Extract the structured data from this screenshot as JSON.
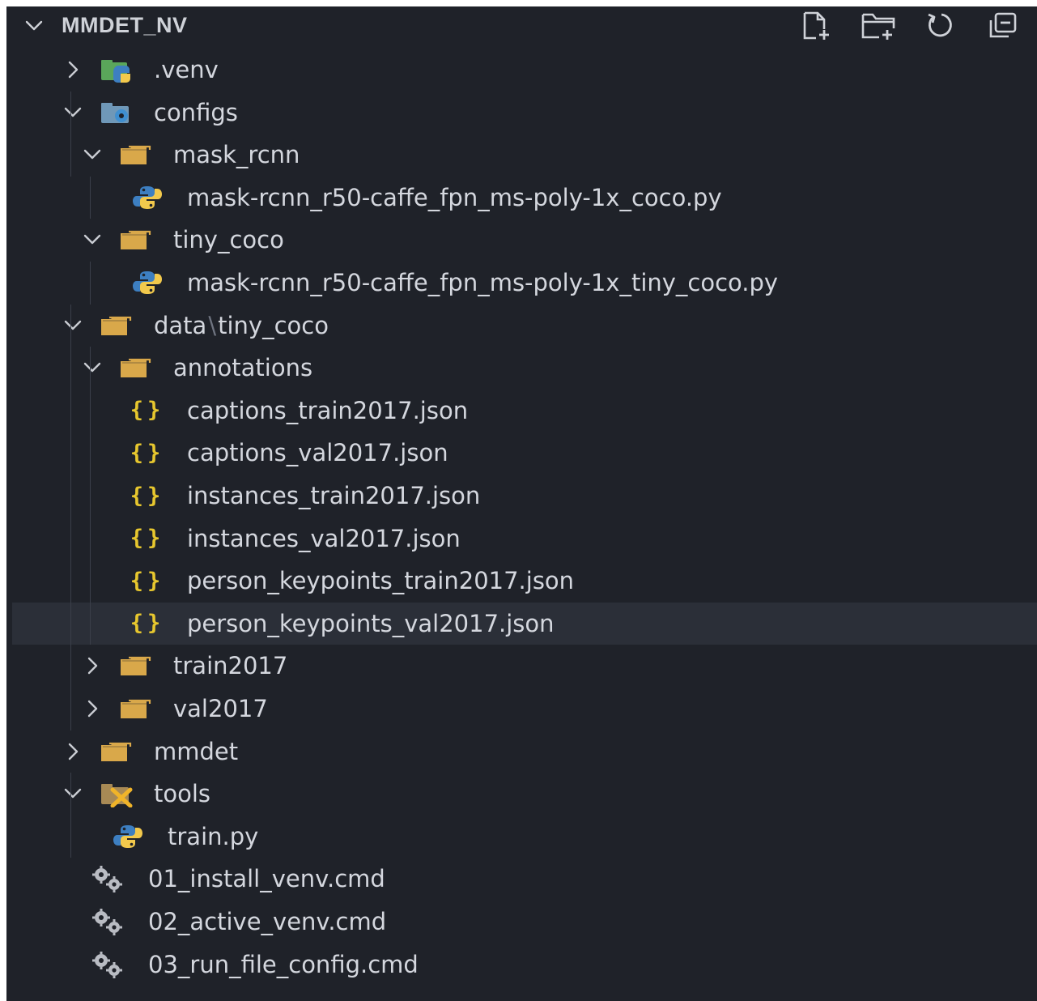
{
  "explorer": {
    "title": "MMDET_NV",
    "actions": {
      "new_file": "new-file-icon",
      "new_folder": "new-folder-icon",
      "refresh": "refresh-icon",
      "collapse_all": "collapse-all-icon"
    }
  },
  "tree": [
    {
      "label": ".venv",
      "type": "folder-venv",
      "expanded": false
    },
    {
      "label": "configs",
      "type": "folder-config",
      "expanded": true
    },
    {
      "label": "mask_rcnn",
      "type": "folder",
      "expanded": true
    },
    {
      "label": "mask-rcnn_r50-caffe_fpn_ms-poly-1x_coco.py",
      "type": "python"
    },
    {
      "label": "tiny_coco",
      "type": "folder",
      "expanded": true
    },
    {
      "label": "mask-rcnn_r50-caffe_fpn_ms-poly-1x_tiny_coco.py",
      "type": "python"
    },
    {
      "label_a": "data",
      "label_sep": "\\",
      "label_b": "tiny_coco",
      "type": "folder",
      "expanded": true
    },
    {
      "label": "annotations",
      "type": "folder",
      "expanded": true
    },
    {
      "label": "captions_train2017.json",
      "type": "json"
    },
    {
      "label": "captions_val2017.json",
      "type": "json"
    },
    {
      "label": "instances_train2017.json",
      "type": "json"
    },
    {
      "label": "instances_val2017.json",
      "type": "json"
    },
    {
      "label": "person_keypoints_train2017.json",
      "type": "json"
    },
    {
      "label": "person_keypoints_val2017.json",
      "type": "json",
      "selected": true
    },
    {
      "label": "train2017",
      "type": "folder",
      "expanded": false
    },
    {
      "label": "val2017",
      "type": "folder",
      "expanded": false
    },
    {
      "label": "mmdet",
      "type": "folder",
      "expanded": false
    },
    {
      "label": "tools",
      "type": "folder-tools",
      "expanded": true
    },
    {
      "label": "train.py",
      "type": "python"
    },
    {
      "label": "01_install_venv.cmd",
      "type": "cmd"
    },
    {
      "label": "02_active_venv.cmd",
      "type": "cmd"
    },
    {
      "label": "03_run_file_config.cmd",
      "type": "cmd"
    }
  ],
  "json_glyph": "{}",
  "colors": {
    "background": "#1f2229",
    "selected_row": "#2b2f38",
    "folder": "#d9a84a",
    "json": "#e7c72e",
    "python_blue": "#3d7fc1",
    "python_yellow": "#f2c94c"
  }
}
